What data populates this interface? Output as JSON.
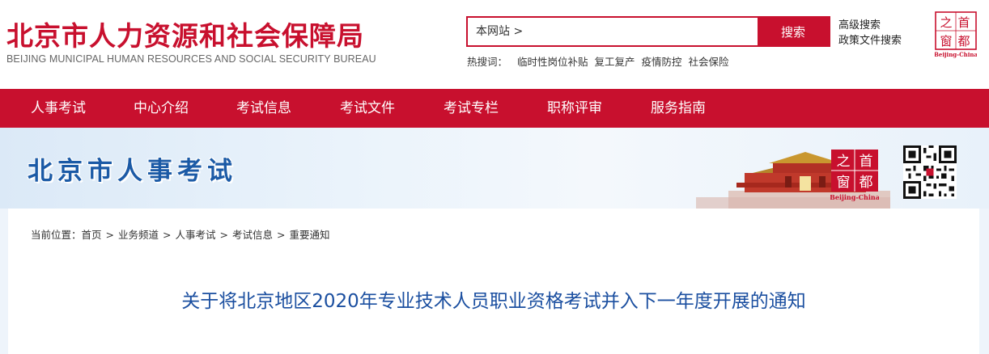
{
  "header": {
    "title": "北京市人力资源和社会保障局",
    "subtitle": "BEIJING MUNICIPAL HUMAN RESOURCES AND SOCIAL SECURITY BUREAU",
    "search": {
      "placeholder": "本网站 >",
      "button_label": "搜索"
    },
    "advanced_search": "高级搜索",
    "policy_search": "政策文件搜索",
    "hot_search": {
      "label": "热搜词：",
      "terms": [
        "临时性岗位补贴",
        "复工复产",
        "疫情防控",
        "社会保险"
      ]
    },
    "seal": {
      "chars": [
        "首",
        "都",
        "之",
        "窗"
      ],
      "caption": "Beijing-China"
    }
  },
  "nav": {
    "items": [
      "人事考试",
      "中心介绍",
      "考试信息",
      "考试文件",
      "考试专栏",
      "职称评审",
      "服务指南"
    ]
  },
  "banner": {
    "title": "北京市人事考试"
  },
  "breadcrumb": {
    "label": "当前位置：",
    "items": [
      "首页",
      "业务频道",
      "人事考试",
      "考试信息",
      "重要通知"
    ],
    "separator": ">"
  },
  "article": {
    "title": "关于将北京地区2020年专业技术人员职业资格考试并入下一年度开展的通知"
  },
  "colors": {
    "brand_red": "#c8102e",
    "title_blue": "#1b4fa0",
    "banner_blue": "#1b5aa6"
  }
}
